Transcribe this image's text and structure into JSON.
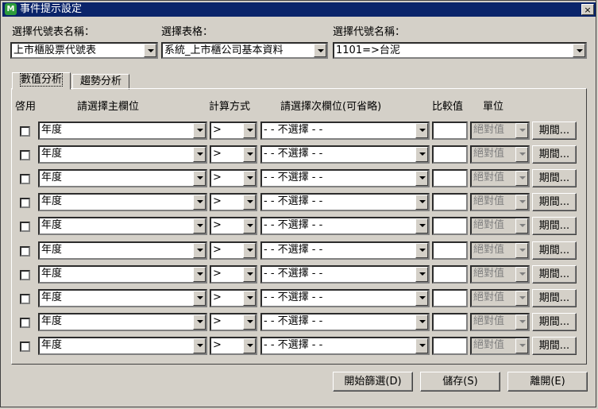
{
  "window": {
    "title": "事件提示設定",
    "close": "×",
    "app_icon": "M"
  },
  "header": {
    "label_code_table": "選擇代號表名稱：",
    "value_code_table": "上市櫃股票代號表",
    "label_table": "選擇表格：",
    "value_table": "系統_上市櫃公司基本資料",
    "label_code_name": "選擇代號名稱：",
    "value_code_name": "1101=>台泥"
  },
  "tabs": [
    {
      "label": "數值分析",
      "active": true
    },
    {
      "label": "趨勢分析",
      "active": false
    }
  ],
  "columns": {
    "enable": "啓用",
    "main_field": "請選擇主欄位",
    "calc": "計算方式",
    "sub_field": "請選擇次欄位(可省略)",
    "compare": "比較值",
    "unit": "單位"
  },
  "rows": [
    {
      "main": "年度",
      "op": ">",
      "sub": "- - 不選擇 - -",
      "compare": "",
      "unit": "絕對值",
      "period": "期間...",
      "checked": false
    },
    {
      "main": "年度",
      "op": ">",
      "sub": "- - 不選擇 - -",
      "compare": "",
      "unit": "絕對值",
      "period": "期間...",
      "checked": false
    },
    {
      "main": "年度",
      "op": ">",
      "sub": "- - 不選擇 - -",
      "compare": "",
      "unit": "絕對值",
      "period": "期間...",
      "checked": false
    },
    {
      "main": "年度",
      "op": ">",
      "sub": "- - 不選擇 - -",
      "compare": "",
      "unit": "絕對值",
      "period": "期間...",
      "checked": false
    },
    {
      "main": "年度",
      "op": ">",
      "sub": "- - 不選擇 - -",
      "compare": "",
      "unit": "絕對值",
      "period": "期間...",
      "checked": false
    },
    {
      "main": "年度",
      "op": ">",
      "sub": "- - 不選擇 - -",
      "compare": "",
      "unit": "絕對值",
      "period": "期間...",
      "checked": false
    },
    {
      "main": "年度",
      "op": ">",
      "sub": "- - 不選擇 - -",
      "compare": "",
      "unit": "絕對值",
      "period": "期間...",
      "checked": false
    },
    {
      "main": "年度",
      "op": ">",
      "sub": "- - 不選擇 - -",
      "compare": "",
      "unit": "絕對值",
      "period": "期間...",
      "checked": false
    },
    {
      "main": "年度",
      "op": ">",
      "sub": "- - 不選擇 - -",
      "compare": "",
      "unit": "絕對值",
      "period": "期間...",
      "checked": false
    },
    {
      "main": "年度",
      "op": ">",
      "sub": "- - 不選擇 - -",
      "compare": "",
      "unit": "絕對值",
      "period": "期間...",
      "checked": false
    }
  ],
  "footer": {
    "filter_button": "開始篩選(D)",
    "save_button": "儲存(S)",
    "exit_button": "離開(E)"
  }
}
